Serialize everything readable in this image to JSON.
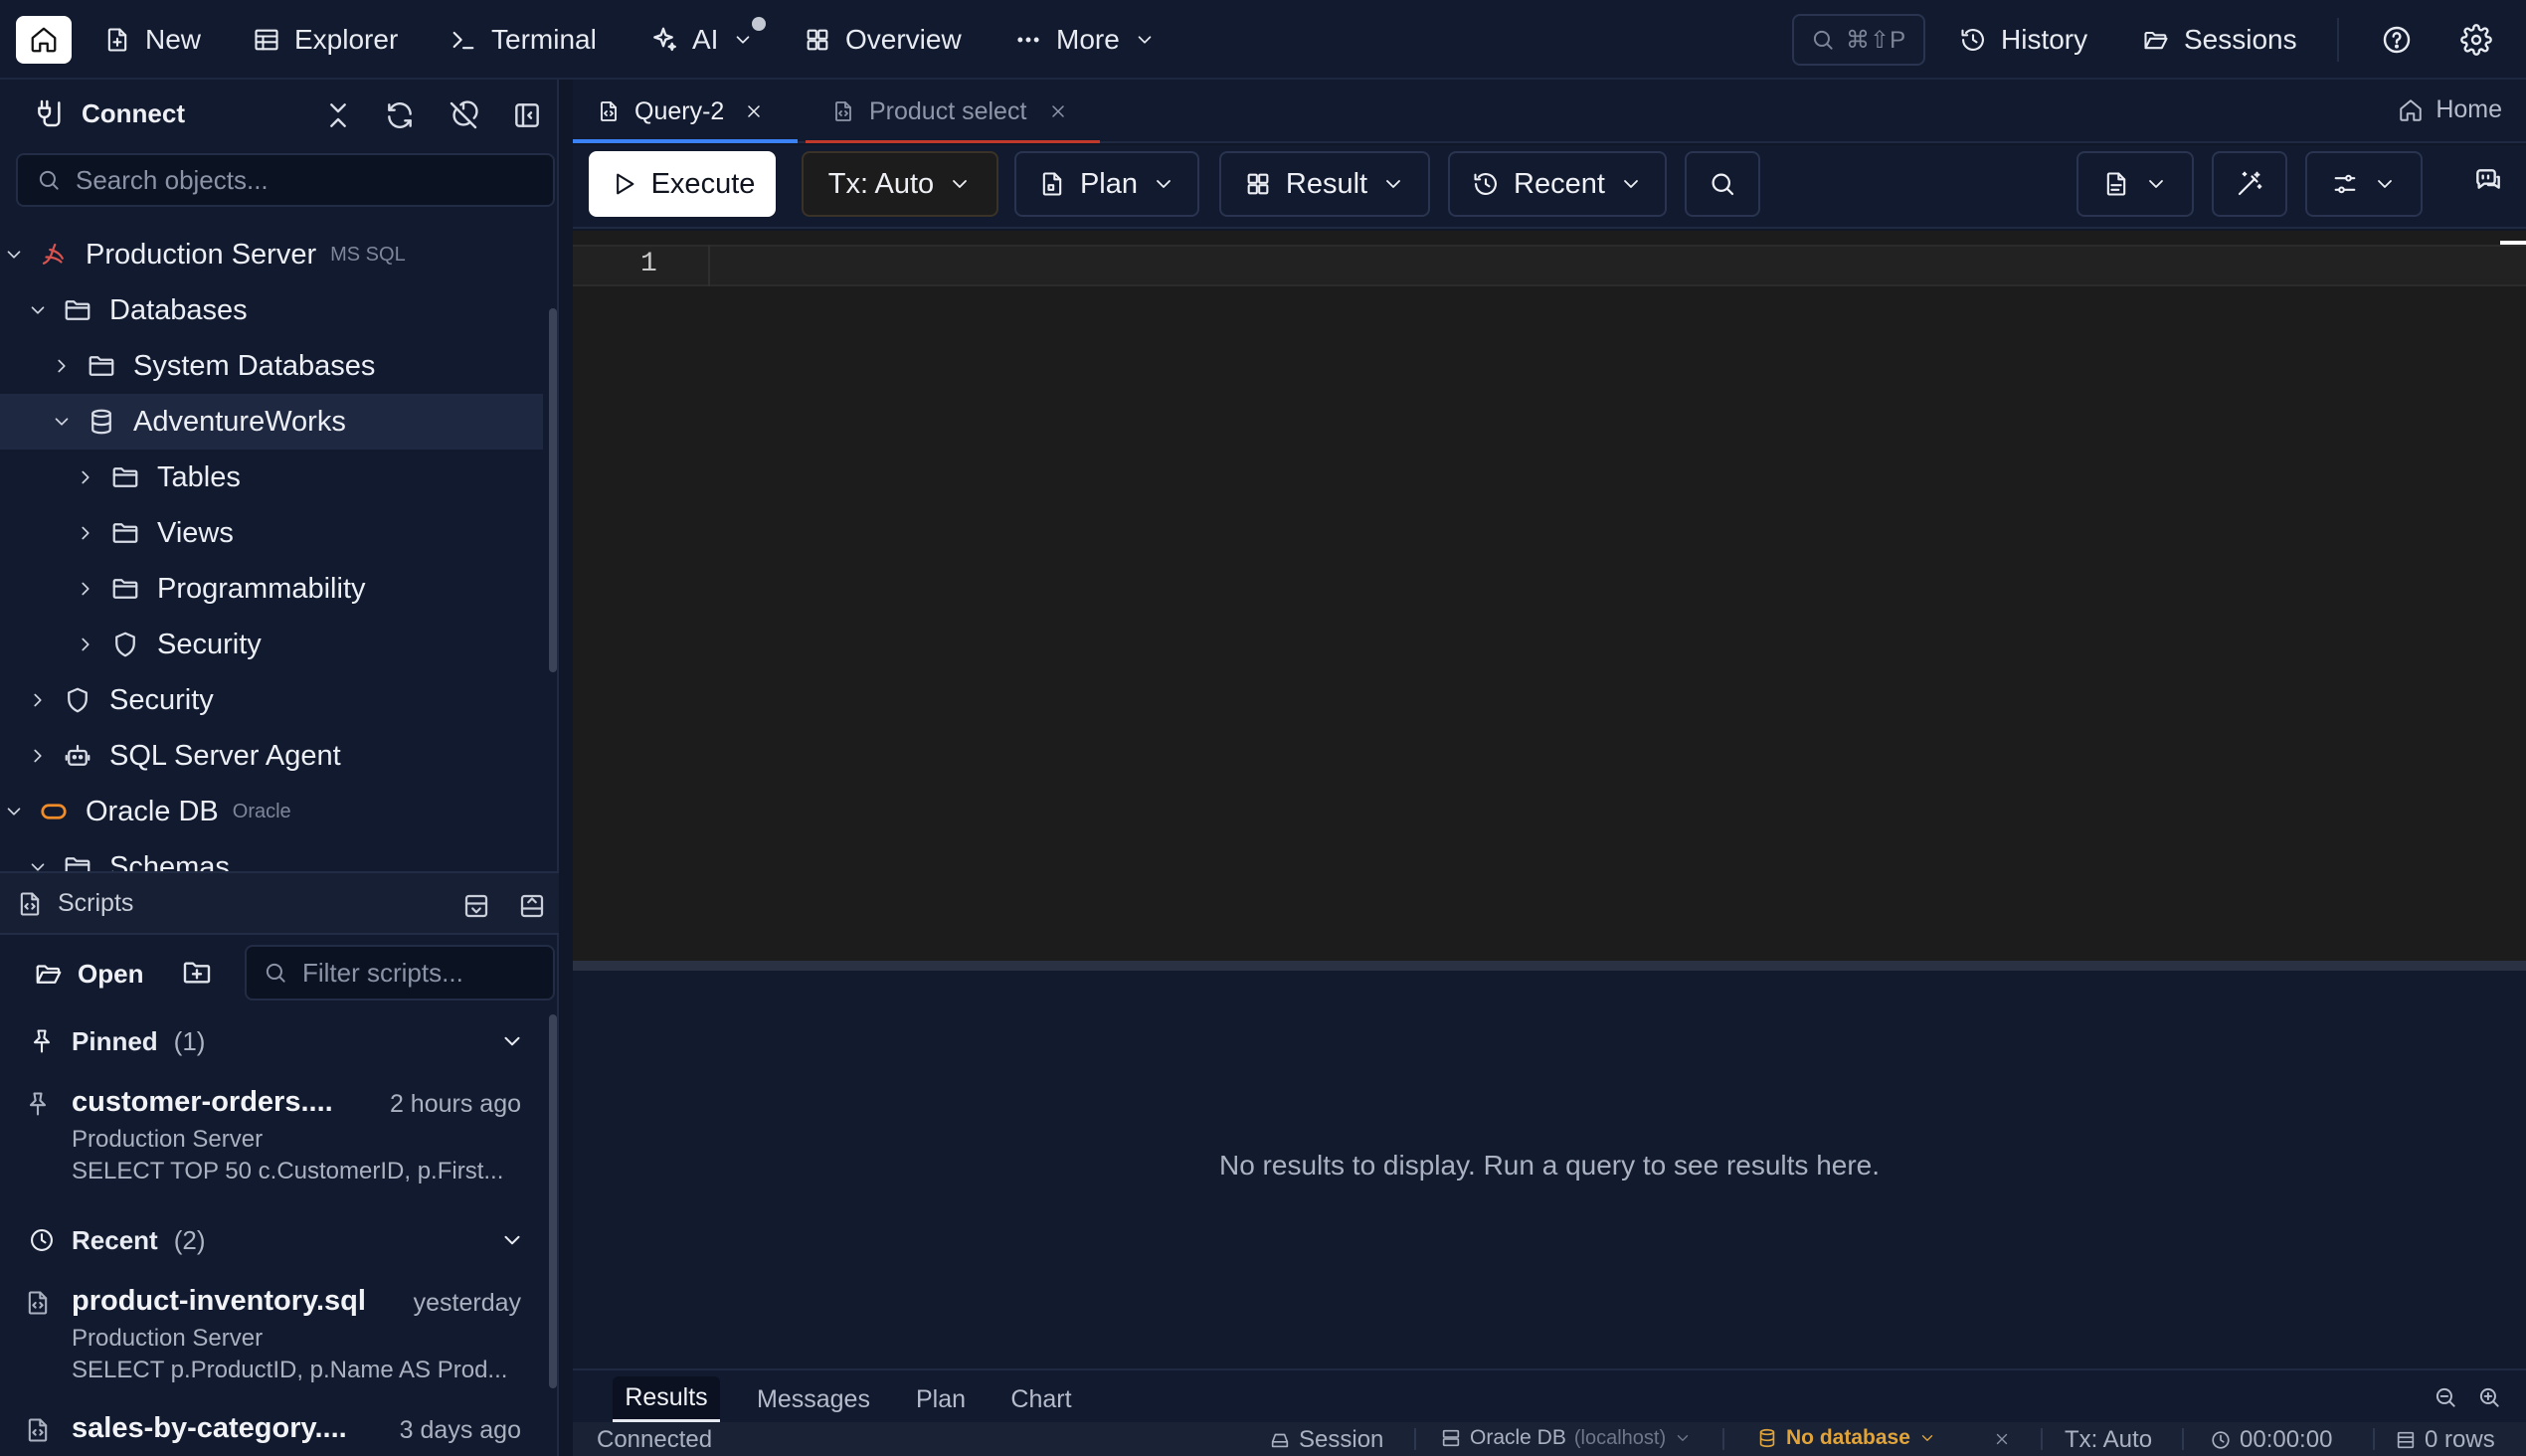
{
  "topbar": {
    "new": "New",
    "explorer": "Explorer",
    "terminal": "Terminal",
    "ai": "AI",
    "overview": "Overview",
    "more": "More",
    "search_shortcut": "⌘⇧P",
    "history": "History",
    "sessions": "Sessions"
  },
  "sidebar": {
    "title": "Connect",
    "search_placeholder": "Search objects...",
    "tree": [
      {
        "label": "Production Server",
        "tag": "MS SQL"
      },
      {
        "label": "Databases"
      },
      {
        "label": "System Databases"
      },
      {
        "label": "AdventureWorks"
      },
      {
        "label": "Tables"
      },
      {
        "label": "Views"
      },
      {
        "label": "Programmability"
      },
      {
        "label": "Security"
      },
      {
        "label": "Security"
      },
      {
        "label": "SQL Server Agent"
      },
      {
        "label": "Oracle DB",
        "tag": "Oracle"
      },
      {
        "label": "Schemas"
      }
    ]
  },
  "scripts": {
    "title": "Scripts",
    "open": "Open",
    "filter_placeholder": "Filter scripts...",
    "pinned": {
      "label": "Pinned",
      "count": "(1)"
    },
    "pinned_items": [
      {
        "name": "customer-orders....",
        "time": "2 hours ago",
        "connection": "Production Server",
        "sql": "SELECT TOP 50 c.CustomerID, p.First..."
      }
    ],
    "recent": {
      "label": "Recent",
      "count": "(2)"
    },
    "recent_items": [
      {
        "name": "product-inventory.sql",
        "time": "yesterday",
        "connection": "Production Server",
        "sql": "SELECT p.ProductID, p.Name AS Prod..."
      },
      {
        "name": "sales-by-category....",
        "time": "3 days ago"
      }
    ]
  },
  "tabs": [
    {
      "label": "Query-2",
      "active": true
    },
    {
      "label": "Product select",
      "active": false
    }
  ],
  "home_link": "Home",
  "toolbar": {
    "execute": "Execute",
    "tx": "Tx: Auto",
    "plan": "Plan",
    "result": "Result",
    "recent": "Recent"
  },
  "editor": {
    "line_numbers": [
      "1"
    ]
  },
  "results": {
    "empty_message": "No results to display. Run a query to see results here.",
    "tabs": [
      "Results",
      "Messages",
      "Plan",
      "Chart"
    ]
  },
  "status": {
    "connected": "Connected",
    "session": "Session",
    "db_name": "Oracle DB",
    "db_host": "(localhost)",
    "database": "No database",
    "tx": "Tx: Auto",
    "time": "00:00:00",
    "rows": "0 rows"
  },
  "colors": {
    "background": "#0f1729",
    "panel": "#111a2e",
    "editor": "#1c1c1c",
    "active_tab_underline": "#3b82f6",
    "inactive_tab_underline": "#c0392b",
    "warning": "#e0a43b",
    "mssql_icon": "#d9534f",
    "oracle_icon": "#f28c28"
  }
}
